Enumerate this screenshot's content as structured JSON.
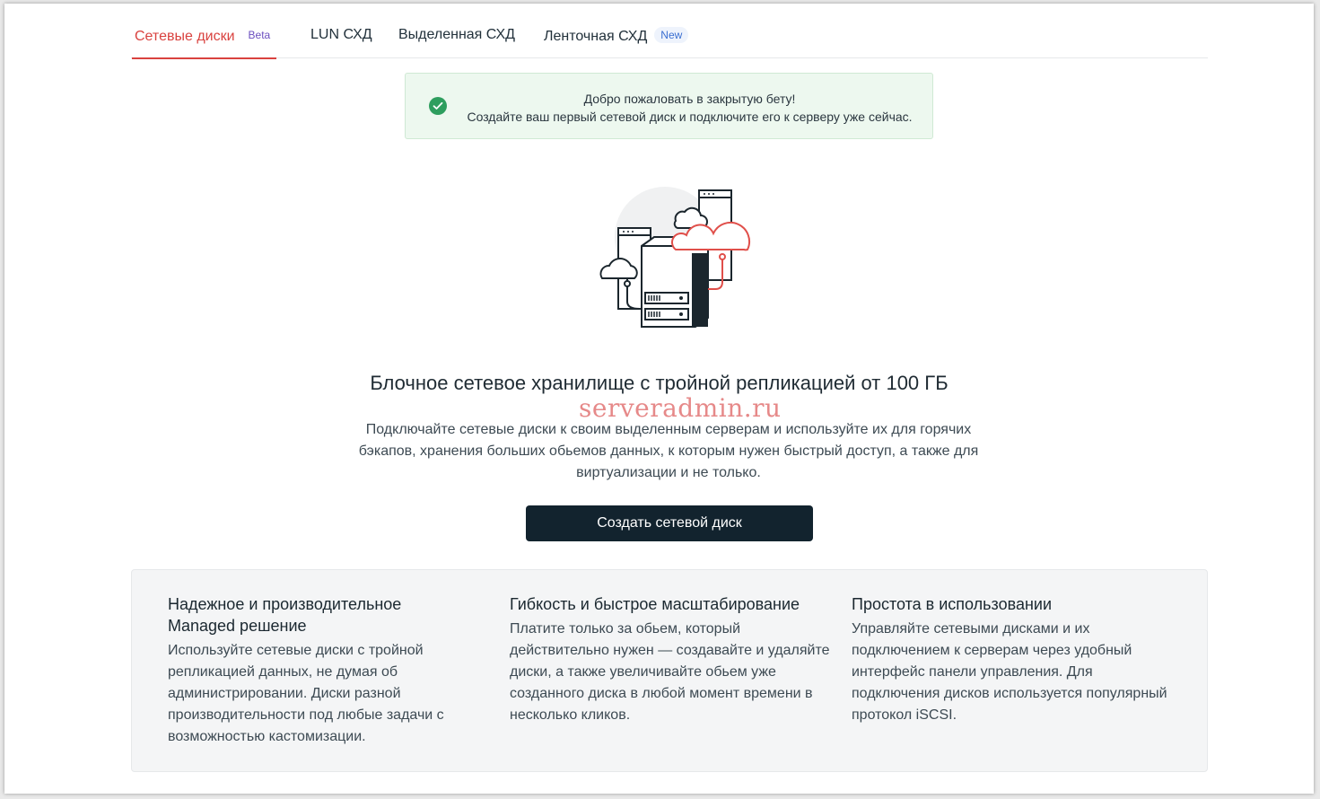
{
  "tabs": [
    {
      "label": "Сетевые диски",
      "badge": "Beta",
      "active": true
    },
    {
      "label": "LUN СХД"
    },
    {
      "label": "Выделенная СХД"
    },
    {
      "label": "Ленточная СХД",
      "badge": "New"
    }
  ],
  "alert": {
    "icon": "check-circle-icon",
    "line1": "Добро пожаловать в закрытую бету!",
    "line2": "Создайте ваш первый сетевой диск и подключите его к серверу уже сейчас."
  },
  "hero": {
    "title": "Блочное сетевое хранилище с тройной репликацией от 100 ГБ",
    "watermark": "serveradmin.ru",
    "description": "Подключайте сетевые диски к своим выделенным серверам и используйте их для горячих бэкапов, хранения больших обьемов данных, к которым нужен быстрый доступ, а также для виртуализации и не только.",
    "cta_label": "Создать сетевой диск"
  },
  "features": [
    {
      "title": "Надежное и производительное Managed решение",
      "text": "Используйте сетевые диски с тройной репликацией данных, не думая об администрировании. Диски разной производительности под любые задачи с возможностью кастомизации."
    },
    {
      "title": "Гибкость и быстрое масштабирование",
      "text": "Платите только за обьем, который действительно нужен — создавайте и удаляйте диски, а также увеличивайте обьем уже созданного диска в любой момент времени в несколько кликов."
    },
    {
      "title": "Простота в использовании",
      "text": "Управляйте сетевыми дисками и их подключением к серверам через удобный интерфейс панели управления. Для подключения дисков используется популярный протокол iSCSI."
    }
  ],
  "colors": {
    "accent": "#d9423f",
    "cta_bg": "#12232e",
    "success": "#2e9e5e"
  }
}
